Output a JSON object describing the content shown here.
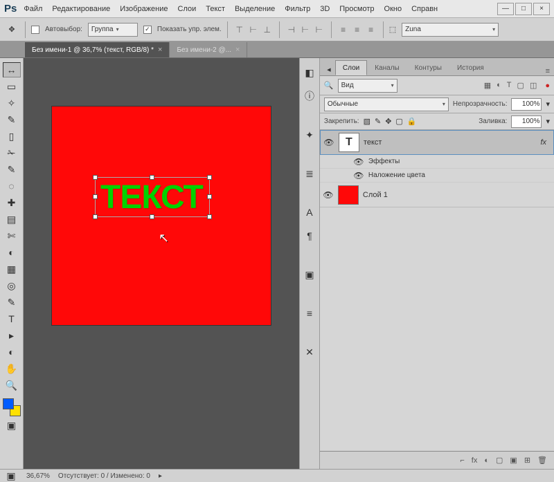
{
  "app": {
    "logo": "Ps"
  },
  "menu": [
    "Файл",
    "Редактирование",
    "Изображение",
    "Слои",
    "Текст",
    "Выделение",
    "Фильтр",
    "3D",
    "Просмотр",
    "Окно",
    "Справн"
  ],
  "window_controls": [
    "—",
    "□",
    "×"
  ],
  "options": {
    "autoselect_label": "Автовыбор:",
    "autoselect_checked": false,
    "mode_select": "Группа",
    "show_controls_checked": true,
    "show_controls_label": "Показать упр. элем.",
    "preset_select": "Zuna"
  },
  "tabs": [
    {
      "label": "Без имени-1 @ 36,7% (текст, RGB/8) *",
      "active": true
    },
    {
      "label": "Без имени-2 @...",
      "active": false
    }
  ],
  "canvas": {
    "text": "ТЕКСТ",
    "bg": "#ff0808",
    "text_color": "#00d200"
  },
  "panels": {
    "tabs": [
      "Слои",
      "Каналы",
      "Контуры",
      "История"
    ],
    "active_tab": 0,
    "filter": {
      "kind_label": "Вид",
      "icons": [
        "▦",
        "◐",
        "T",
        "▢",
        "◫"
      ],
      "dot": "●"
    },
    "blend": {
      "mode": "Обычные",
      "opacity_label": "Непрозрачность:",
      "opacity": "100%"
    },
    "lock": {
      "label": "Закрепить:",
      "fill_label": "Заливка:",
      "fill": "100%"
    },
    "layers": [
      {
        "name": "текст",
        "type": "T",
        "visible": true,
        "selected": true,
        "fx": true
      },
      {
        "name": "Слой 1",
        "type": "color",
        "visible": true,
        "selected": false
      }
    ],
    "effects": {
      "label": "Эффекты",
      "items": [
        "Наложение цвета"
      ]
    },
    "bottom_icons": [
      "⌐",
      "fx",
      "◐",
      "▢",
      "▣",
      "⊞",
      "🗑"
    ]
  },
  "mini_icons_left": [
    "⎋",
    "ⓘ",
    "",
    "✦",
    "",
    "≡",
    "",
    "A",
    "¶",
    "",
    "▣",
    "",
    "≡",
    "",
    "✕"
  ],
  "tools": [
    "↔",
    "▭",
    "✧",
    "✎",
    "▯",
    "✁",
    "✎",
    "◌",
    "✚",
    "▤",
    "✄",
    "◐",
    "▦",
    "◎",
    "✎",
    "◬",
    "T",
    "▸",
    "◐",
    "✋",
    "🔍"
  ],
  "status": {
    "zoom": "36,67%",
    "info": "Отсутствует: 0 / Изменено: 0"
  },
  "swatches": {
    "fg": "#005cff",
    "bg": "#ffe100"
  }
}
